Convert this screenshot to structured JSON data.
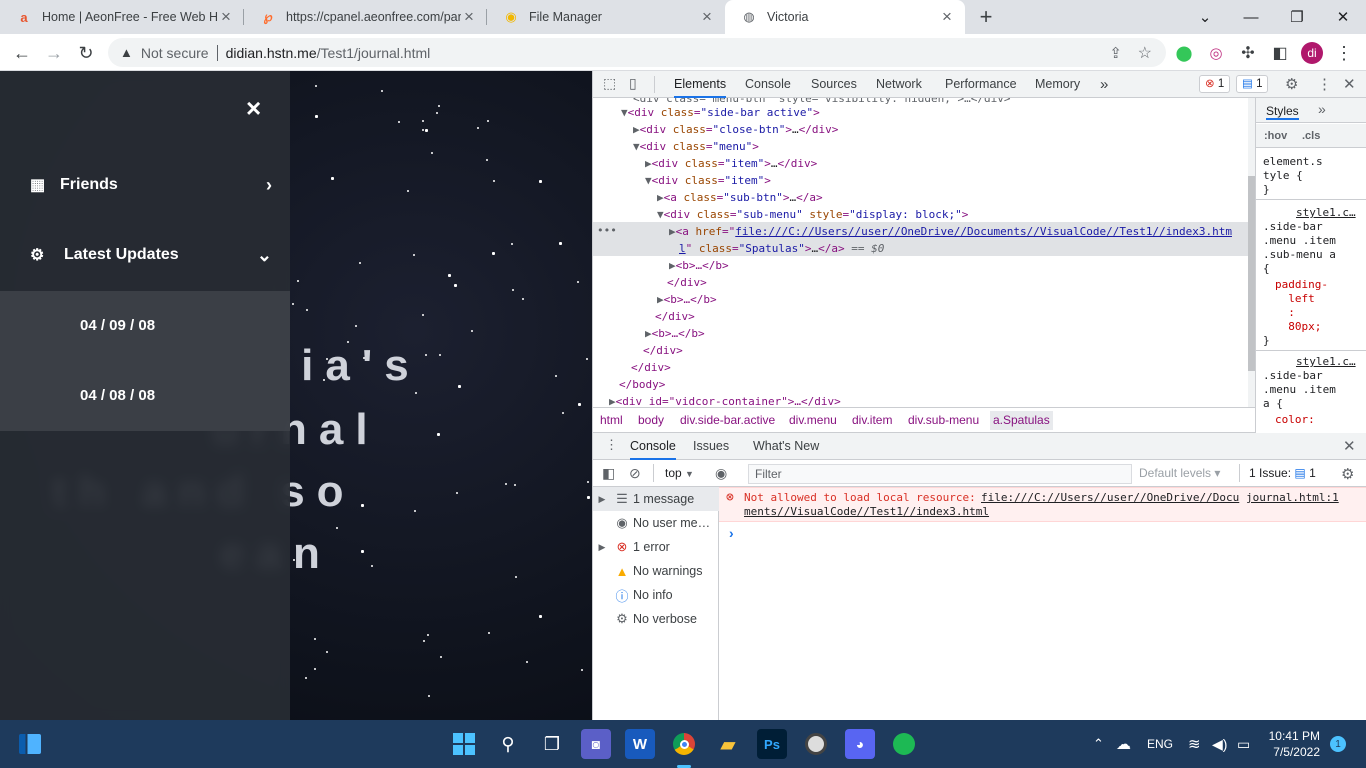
{
  "browser": {
    "tabs": [
      {
        "title": "Home | AeonFree - Free Web Ho",
        "favicon": "aeonfree-icon"
      },
      {
        "title": "https://cpanel.aeonfree.com/pan",
        "favicon": "cpanel-icon"
      },
      {
        "title": "File Manager",
        "favicon": "file-manager-icon"
      },
      {
        "title": "Victoria",
        "favicon": "globe-icon"
      }
    ],
    "new_tab": "+",
    "security": "Not secure",
    "url_host": "didian.hstn.me",
    "url_path": "/Test1/journal.html",
    "profile_initials": "di"
  },
  "page": {
    "close": "×",
    "menu": [
      {
        "label": "Friends",
        "icon": "grid-icon",
        "chevron": "›"
      },
      {
        "label": "Latest Updates",
        "icon": "gears-icon",
        "chevron": "⌄"
      }
    ],
    "submenu": [
      "04 / 09 / 08",
      "04 / 08 / 08"
    ],
    "bg_lines": [
      "ctoria's",
      "urnal",
      "th and so",
      "ean"
    ]
  },
  "devtools": {
    "tabs": [
      "Elements",
      "Console",
      "Sources",
      "Network",
      "Performance",
      "Memory"
    ],
    "more": "»",
    "error_count": "1",
    "issue_count": "1",
    "dom": {
      "l0": "<div class=\"menu-btn\" style=\"visibility: hidden;\">…</div>",
      "l1_tag": "div",
      "l1_attr": "class",
      "l1_val": "\"side-bar active\"",
      "l2_val": "\"close-btn\"",
      "l3_val": "\"menu\"",
      "l4_val": "\"item\"",
      "l5_val": "\"item\"",
      "l6_val": "\"sub-btn\"",
      "l7_val": "\"sub-menu\"",
      "l7_style": "\"display: block;\"",
      "href_a": "file:///C://Users//user//OneDrive//Documents//VisualCode//Test1//index3.htm",
      "href_b": "l",
      "spatulas_val": "\"Spatulas\"",
      "eq": "== $0",
      "b1": "<b>…</b>",
      "close_div": "</div>",
      "close_body": "</body>",
      "last": "<div id=\"vidcor-container\">…</div>"
    },
    "breadcrumbs": [
      "html",
      "body",
      "div.side-bar.active",
      "div.menu",
      "div.item",
      "div.sub-menu",
      "a.Spatulas"
    ],
    "styles": {
      "tab": "Styles",
      "filters": [
        ":hov",
        ".cls"
      ],
      "rule1": "element.s\ntyle {\n}",
      "rule2_src": "style1.c…",
      "rule2": ".side-bar\n.menu .item\n.sub-menu a\n{",
      "rule2_prop": "padding-\n  left\n  :\n  80px;",
      "rule3_src": "style1.c…",
      "rule3": ".side-bar\n.menu .item\na {",
      "rule3_prop": "color:"
    },
    "drawer": {
      "tabs": [
        "Console",
        "Issues",
        "What's New"
      ],
      "context": "top",
      "filter_placeholder": "Filter",
      "levels": "Default levels",
      "issues": "1 Issue:",
      "issues_count": "1",
      "sidebar": [
        {
          "label": "1 message",
          "icon": "list-icon",
          "arrow": true
        },
        {
          "label": "No user me…",
          "icon": "user-icon",
          "arrow": false
        },
        {
          "label": "1 error",
          "icon": "error-icon",
          "arrow": true
        },
        {
          "label": "No warnings",
          "icon": "warning-icon",
          "arrow": false
        },
        {
          "label": "No info",
          "icon": "info-icon",
          "arrow": false
        },
        {
          "label": "No verbose",
          "icon": "verbose-icon",
          "arrow": false
        }
      ],
      "error_text": "Not allowed to load local resource:",
      "error_link1": "file:///C://Users//user//OneDrive//Docu",
      "error_link2": "ments//VisualCode//Test1//index3.html",
      "error_src": "journal.html:1",
      "prompt": "›"
    }
  },
  "taskbar": {
    "lang": "ENG",
    "time": "10:41 PM",
    "date": "7/5/2022",
    "notif": "1"
  },
  "colors": {
    "accent": "#1a73e8",
    "error": "#d93025",
    "taskbar": "#1e3a5c"
  }
}
